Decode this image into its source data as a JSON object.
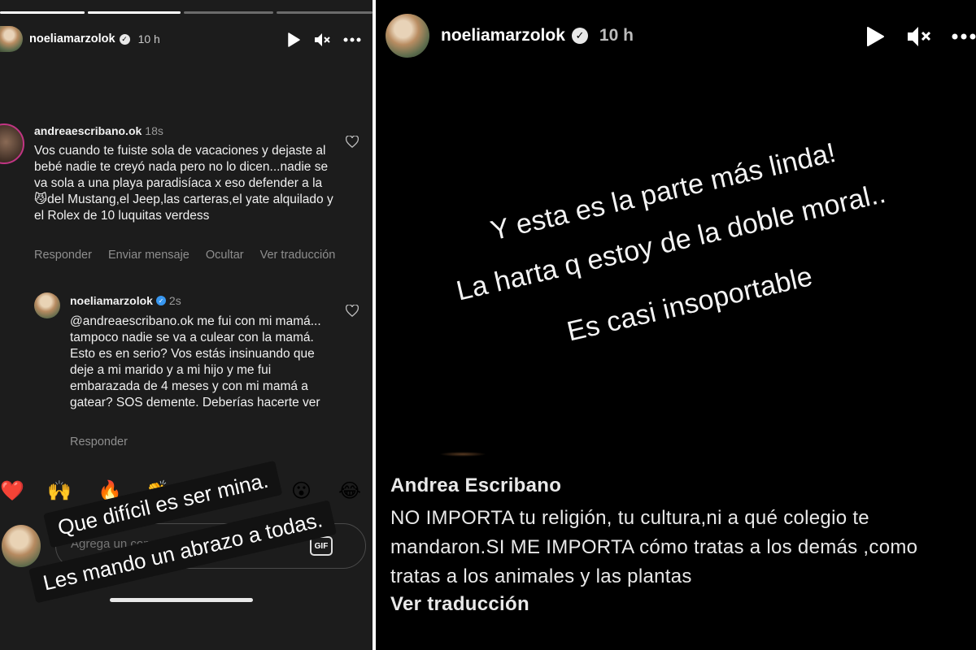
{
  "left_story": {
    "progress": [
      1.0,
      1.0,
      0.0,
      0.0
    ],
    "header": {
      "username": "noeliamarzolok",
      "verified": true,
      "time": "10 h"
    },
    "controls": [
      "play-icon",
      "mute-icon",
      "more-icon"
    ],
    "comment": {
      "username": "andreaescribano.ok",
      "time": "18s",
      "text": "Vos cuando te fuiste sola de vacaciones y dejaste al bebé nadie te creyó nada pero no lo dicen...nadie se va sola a una playa paradisíaca x eso defender a la 😼del Mustang,el Jeep,las carteras,el yate alquilado y el Rolex de 10 luquitas verdess",
      "actions": [
        "Responder",
        "Enviar mensaje",
        "Ocultar",
        "Ver traducción"
      ]
    },
    "reply": {
      "username": "noeliamarzolok",
      "verified": true,
      "time": "2s",
      "text": "@andreaescribano.ok me fui con mi mamá... tampoco nadie se va a culear con la mamá. Esto es en serio? Vos estás insinuando que deje a mi marido y a mi hijo y me fui embarazada de 4 meses y con mi mamá a gatear? SOS demente. Deberías hacerte ver",
      "actions": [
        "Responder"
      ]
    },
    "reactions": [
      "❤️",
      "🙌",
      "🔥",
      "👏",
      "😢",
      "😍",
      "😮",
      "😂"
    ],
    "comment_input": {
      "placeholder": "Agrega un comentario como no..."
    },
    "gif_label": "GIF",
    "sticker_lines": [
      "Que difícil es ser mina.",
      "Les mando un abrazo a todas."
    ]
  },
  "right_story": {
    "header": {
      "username": "noeliamarzolok",
      "verified": true,
      "time": "10 h"
    },
    "controls": [
      "play-icon",
      "mute-icon",
      "more-icon"
    ],
    "story_lines": [
      "Y esta es la parte más linda!",
      "La harta q estoy de la doble moral..",
      "Es casi insoportable"
    ],
    "quoted_comment": {
      "name": "Andrea Escribano",
      "text": "NO IMPORTA tu religión, tu cultura,ni a qué colegio te mandaron.SI ME IMPORTA cómo tratas a los demás ,como tratas a los animales y las plantas",
      "translate_label": "Ver traducción"
    }
  }
}
